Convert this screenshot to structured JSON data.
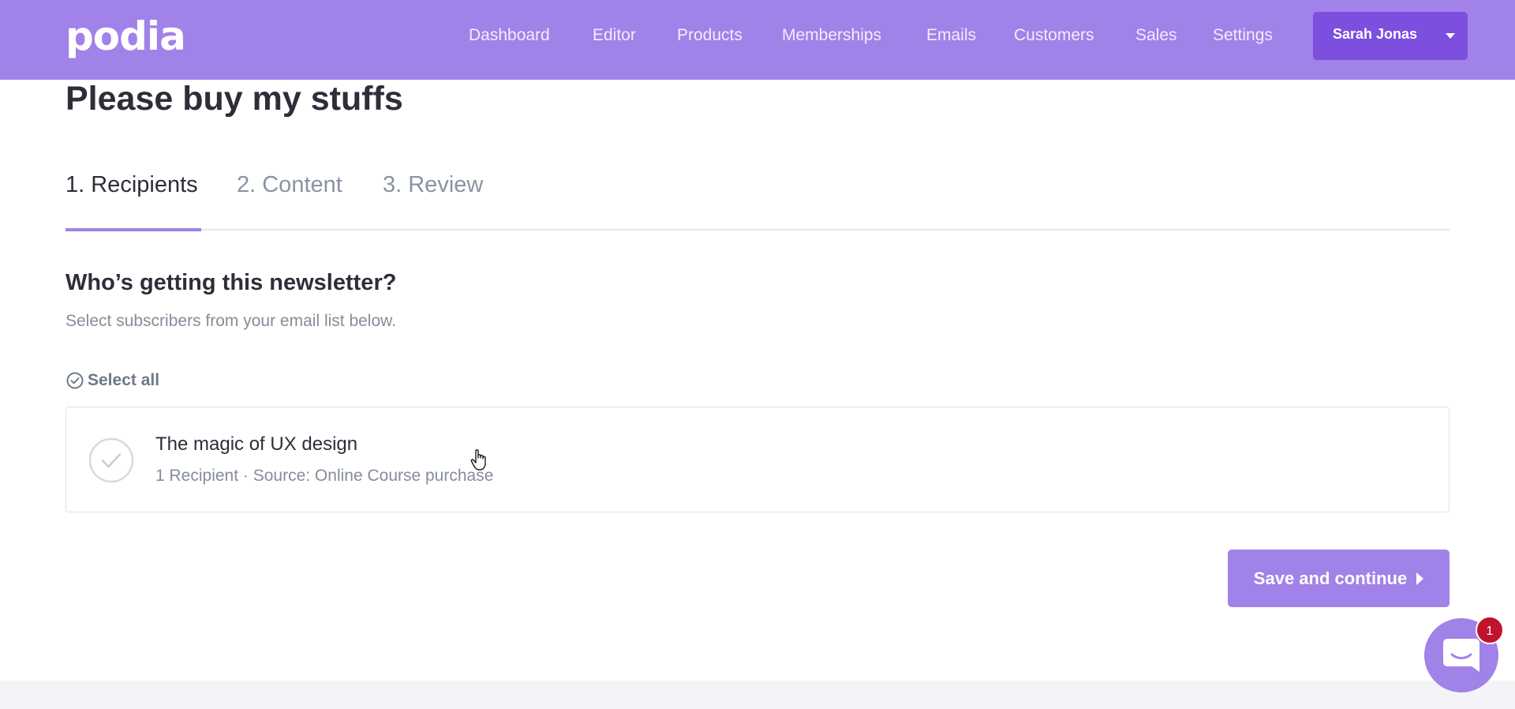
{
  "brand": {
    "logo_text": "podia"
  },
  "nav": {
    "items": [
      {
        "label": "Dashboard"
      },
      {
        "label": "Editor"
      },
      {
        "label": "Products"
      },
      {
        "label": "Memberships"
      },
      {
        "label": "Emails"
      },
      {
        "label": "Customers"
      },
      {
        "label": "Sales"
      },
      {
        "label": "Settings"
      }
    ]
  },
  "user": {
    "name": "Sarah Jonas"
  },
  "page": {
    "title": "Please buy my stuffs"
  },
  "tabs": [
    {
      "label": "1. Recipients",
      "active": true
    },
    {
      "label": "2. Content",
      "active": false
    },
    {
      "label": "3. Review",
      "active": false
    }
  ],
  "recipients": {
    "heading": "Who’s getting this newsletter?",
    "subheading": "Select subscribers from your email list below.",
    "select_all_label": "Select all",
    "lists": [
      {
        "title": "The magic of UX design",
        "meta": "1 Recipient · Source: Online Course purchase",
        "selected": false
      }
    ]
  },
  "actions": {
    "save_label": "Save and continue"
  },
  "chat": {
    "badge_count": "1"
  },
  "colors": {
    "brand_purple": "#a182e8",
    "user_button": "#7c4fdf",
    "badge_red": "#c0132c"
  },
  "icons": {
    "select_all": "check-circle-icon",
    "list_check": "check-circle-icon",
    "save_arrow": "caret-right-icon",
    "user_caret": "caret-down-icon",
    "chat": "chat-bubble-icon"
  }
}
